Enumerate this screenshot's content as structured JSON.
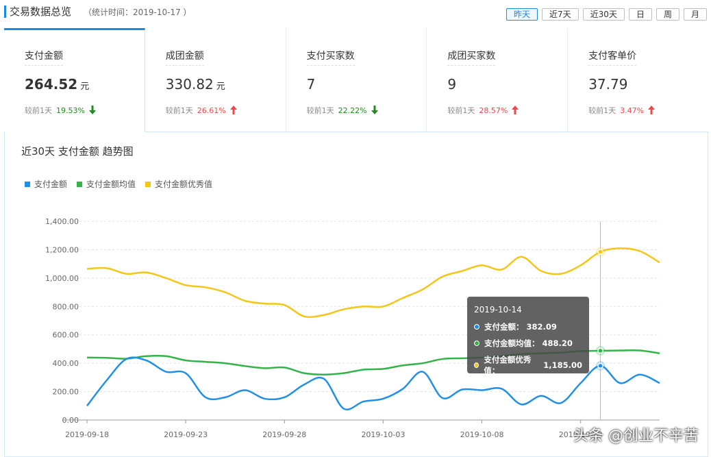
{
  "header": {
    "title": "交易数据总览",
    "subtitle": "（统计时间：2019-10-17 ）"
  },
  "periods": [
    {
      "label": "昨天",
      "active": true
    },
    {
      "label": "近7天",
      "active": false
    },
    {
      "label": "近30天",
      "active": false
    },
    {
      "label": "日",
      "active": false
    },
    {
      "label": "周",
      "active": false
    },
    {
      "label": "月",
      "active": false
    }
  ],
  "cards": [
    {
      "name": "支付金额",
      "value": "264.52",
      "unit": "元",
      "compare_label": "较前1天",
      "pct": "19.53%",
      "trend": "down"
    },
    {
      "name": "成团金额",
      "value": "330.82",
      "unit": "元",
      "compare_label": "较前1天",
      "pct": "26.61%",
      "trend": "up"
    },
    {
      "name": "支付买家数",
      "value": "7",
      "unit": "",
      "compare_label": "较前1天",
      "pct": "22.22%",
      "trend": "down"
    },
    {
      "name": "成团买家数",
      "value": "9",
      "unit": "",
      "compare_label": "较前1天",
      "pct": "28.57%",
      "trend": "up"
    },
    {
      "name": "支付客单价",
      "value": "37.79",
      "unit": "",
      "compare_label": "较前1天",
      "pct": "3.47%",
      "trend": "up"
    }
  ],
  "chart_title": "近30天 支付金额 趋势图",
  "colors": {
    "accent": "#1a8ae6",
    "series_blue": "#1f8fe8",
    "series_green": "#33b44a",
    "series_yellow": "#f5c518",
    "up": "#f04848",
    "down": "#1f8a1f"
  },
  "chart_data": {
    "type": "line",
    "title": "近30天 支付金额 趋势图",
    "x": [
      "2019-09-18",
      "2019-09-19",
      "2019-09-20",
      "2019-09-21",
      "2019-09-22",
      "2019-09-23",
      "2019-09-24",
      "2019-09-25",
      "2019-09-26",
      "2019-09-27",
      "2019-09-28",
      "2019-09-29",
      "2019-09-30",
      "2019-10-01",
      "2019-10-02",
      "2019-10-03",
      "2019-10-04",
      "2019-10-05",
      "2019-10-06",
      "2019-10-07",
      "2019-10-08",
      "2019-10-09",
      "2019-10-10",
      "2019-10-11",
      "2019-10-12",
      "2019-10-13",
      "2019-10-14",
      "2019-10-15",
      "2019-10-16"
    ],
    "x_tick_labels": [
      "2019-09-18",
      "2019-09-23",
      "2019-09-28",
      "2019-10-03",
      "2019-10-08",
      "2019-10-13"
    ],
    "ylim": [
      0,
      1400
    ],
    "y_tick_labels": [
      "0.00",
      "200.00",
      "400.00",
      "600.00",
      "800.00",
      "1,000.00",
      "1,200.00",
      "1,400.00"
    ],
    "grid": true,
    "legend_position": "top-left",
    "series": [
      {
        "name": "支付金额",
        "color": "#1f8fe8",
        "values": [
          100,
          280,
          430,
          420,
          340,
          330,
          160,
          160,
          210,
          150,
          160,
          250,
          290,
          80,
          130,
          150,
          220,
          340,
          155,
          215,
          210,
          220,
          110,
          170,
          120,
          260,
          382.09,
          260,
          320,
          260
        ]
      },
      {
        "name": "支付金额均值",
        "color": "#33b44a",
        "values": [
          440,
          438,
          432,
          450,
          450,
          420,
          410,
          400,
          380,
          365,
          370,
          330,
          320,
          330,
          355,
          360,
          385,
          400,
          430,
          435,
          440,
          450,
          465,
          470,
          475,
          485,
          488.2,
          490,
          490,
          470
        ]
      },
      {
        "name": "支付金额优秀值",
        "color": "#f5c518",
        "values": [
          1065,
          1070,
          1030,
          1040,
          1000,
          950,
          935,
          900,
          840,
          820,
          810,
          730,
          740,
          780,
          800,
          800,
          860,
          920,
          1010,
          1050,
          1090,
          1060,
          1150,
          1050,
          1030,
          1090,
          1185,
          1210,
          1190,
          1110
        ]
      }
    ],
    "tooltip": {
      "date": "2019-10-14",
      "rows": [
        {
          "label": "支付金额：",
          "value": "382.09",
          "color": "#1f8fe8"
        },
        {
          "label": "支付金额均值：",
          "value": "488.20",
          "color": "#33b44a"
        },
        {
          "label": "支付金额优秀值：",
          "value": "1,185.00",
          "color": "#f5c518"
        }
      ]
    }
  },
  "watermark": "头条 @创业不辛苦"
}
